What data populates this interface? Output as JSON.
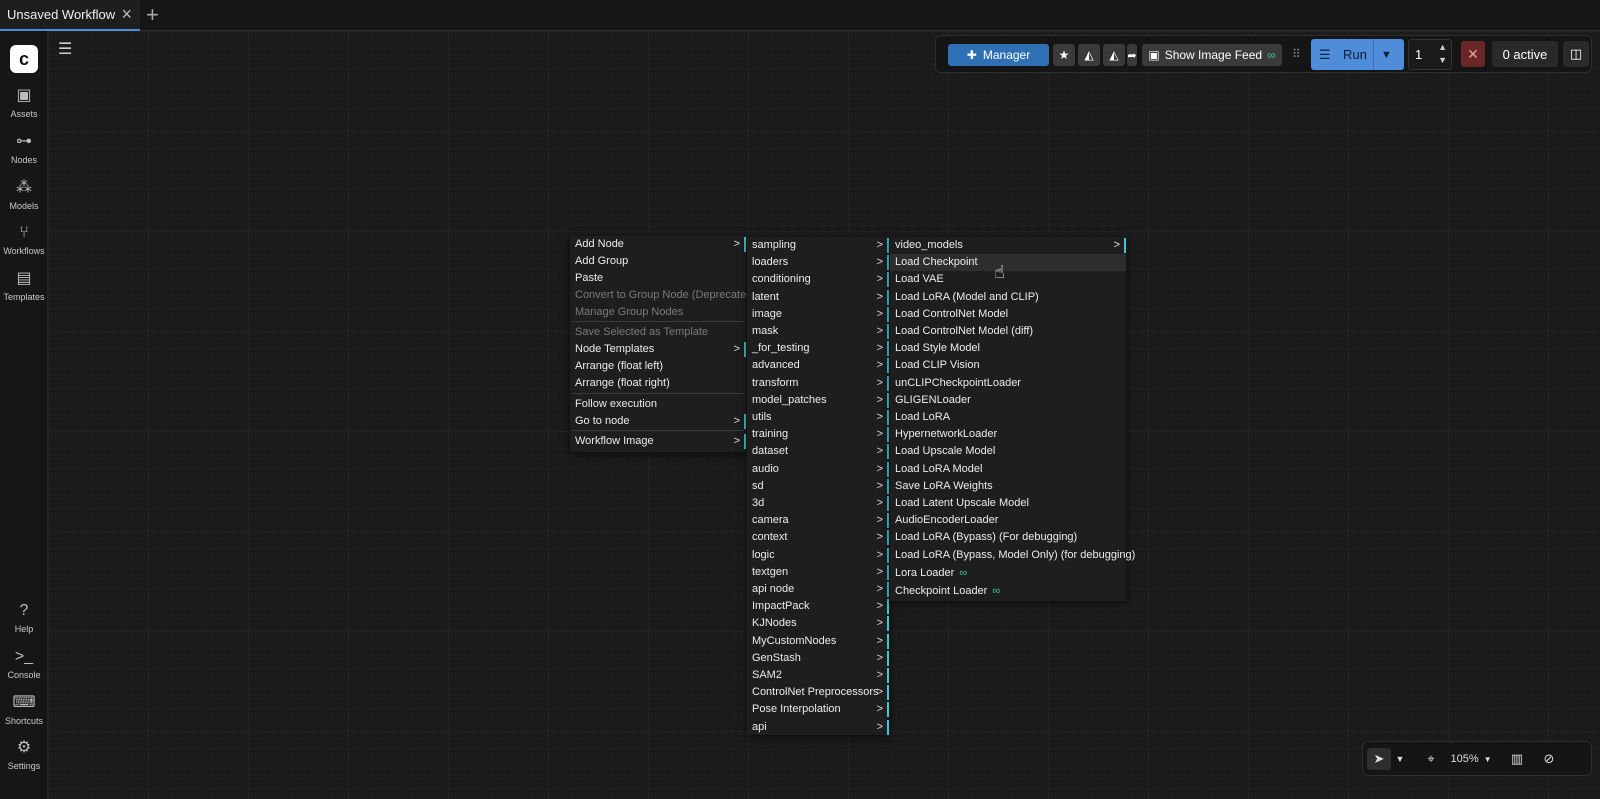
{
  "tabs": {
    "active_title": "Unsaved Workflow",
    "close_icon": "×",
    "add_icon": "+"
  },
  "sidebar": {
    "logo": "c",
    "items": [
      {
        "label": "Assets",
        "icon": "image-icon",
        "glyph": "▣"
      },
      {
        "label": "Nodes",
        "icon": "node-icon",
        "glyph": "⊶"
      },
      {
        "label": "Models",
        "icon": "models-icon",
        "glyph": "⁂"
      },
      {
        "label": "Workflows",
        "icon": "workflow-icon",
        "glyph": "⑂"
      },
      {
        "label": "Templates",
        "icon": "templates-icon",
        "glyph": "▤"
      }
    ],
    "bottom_items": [
      {
        "label": "Help",
        "icon": "help-icon",
        "glyph": "?"
      },
      {
        "label": "Console",
        "icon": "console-icon",
        "glyph": ">_"
      },
      {
        "label": "Shortcuts",
        "icon": "keyboard-icon",
        "glyph": "⌨"
      },
      {
        "label": "Settings",
        "icon": "gear-icon",
        "glyph": "⚙"
      }
    ]
  },
  "toolbar": {
    "manager_label": "Manager",
    "show_image_feed_label": "Show Image Feed",
    "run_label": "Run",
    "batch_count": "1",
    "active_label": "0 active",
    "accent": "#4f8ddb"
  },
  "menu_main": [
    {
      "label": "Add Node",
      "sub": true
    },
    {
      "label": "Add Group"
    },
    {
      "label": "Paste"
    },
    {
      "label": "Convert to Group Node (Deprecated)",
      "disabled": true
    },
    {
      "label": "Manage Group Nodes",
      "disabled": true
    },
    {
      "label": "Save Selected as Template",
      "disabled": true
    },
    {
      "label": "Node Templates",
      "sub": true
    },
    {
      "label": "Arrange (float left)"
    },
    {
      "label": "Arrange (float right)"
    },
    {
      "label": "Follow execution"
    },
    {
      "label": "Go to node",
      "sub": true
    },
    {
      "label": "Workflow Image",
      "sub": true
    }
  ],
  "menu_categories": [
    "sampling",
    "loaders",
    "conditioning",
    "latent",
    "image",
    "mask",
    "_for_testing",
    "advanced",
    "transform",
    "model_patches",
    "utils",
    "training",
    "dataset",
    "audio",
    "sd",
    "3d",
    "camera",
    "context",
    "logic",
    "textgen",
    "api node",
    "ImpactPack",
    "KJNodes",
    "MyCustomNodes",
    "GenStash",
    "SAM2",
    "ControlNet Preprocessors",
    "Pose Interpolation",
    "api"
  ],
  "menu_loaders": [
    {
      "label": "video_models",
      "sub": true
    },
    {
      "label": "Load Checkpoint",
      "highlight": true
    },
    {
      "label": "Load VAE"
    },
    {
      "label": "Load LoRA (Model and CLIP)"
    },
    {
      "label": "Load ControlNet Model"
    },
    {
      "label": "Load ControlNet Model (diff)"
    },
    {
      "label": "Load Style Model"
    },
    {
      "label": "Load CLIP Vision"
    },
    {
      "label": "unCLIPCheckpointLoader"
    },
    {
      "label": "GLIGENLoader"
    },
    {
      "label": "Load LoRA"
    },
    {
      "label": "HypernetworkLoader"
    },
    {
      "label": "Load Upscale Model"
    },
    {
      "label": "Load LoRA Model"
    },
    {
      "label": "Save LoRA Weights"
    },
    {
      "label": "Load Latent Upscale Model"
    },
    {
      "label": "AudioEncoderLoader"
    },
    {
      "label": "Load LoRA (Bypass) (For debugging)"
    },
    {
      "label": "Load LoRA (Bypass, Model Only) (for debugging)"
    },
    {
      "label": "Lora Loader",
      "badge": true
    },
    {
      "label": "Checkpoint Loader",
      "badge": true
    }
  ],
  "zoom": {
    "level": "105%"
  }
}
